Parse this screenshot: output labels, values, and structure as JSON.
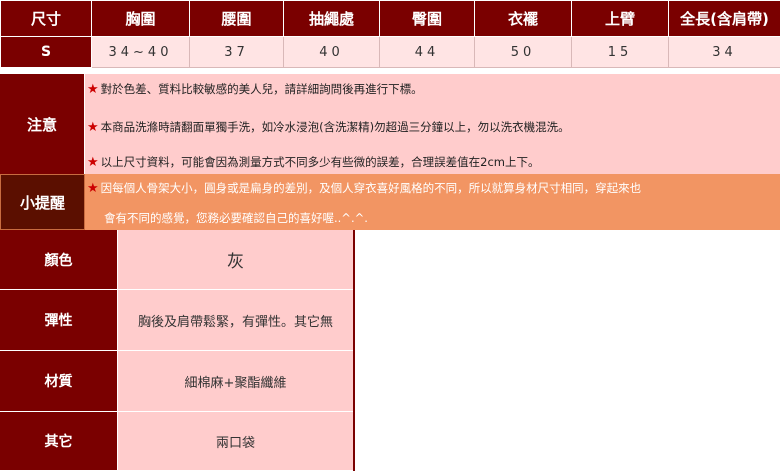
{
  "size_table": {
    "headers": [
      "尺寸",
      "胸圍",
      "腰圍",
      "抽繩處",
      "臀圍",
      "衣襬",
      "上臂",
      "全長(含肩帶)"
    ],
    "rows": [
      {
        "size": "S",
        "values": [
          "34~40",
          "37",
          "40",
          "44",
          "50",
          "15",
          "34"
        ]
      }
    ]
  },
  "notes": {
    "label": "注意",
    "star_glyph": "★",
    "lines": [
      "對於色差、質料比較敏感的美人兒，請詳細詢問後再進行下標。",
      "本商品洗滌時請翻面單獨手洗，如冷水浸泡(含洗潔精)勿超過三分鐘以上，勿以洗衣機混洗。",
      "以上尺寸資料，可能會因為測量方式不同多少有些微的誤差，合理誤差值在2cm上下。"
    ]
  },
  "reminder": {
    "label": "小提醒",
    "line1": "因每個人骨架大小，圓身或是扁身的差別，及個人穿衣喜好風格的不同，所以就算身材尺寸相同，穿起來也",
    "line2": "會有不同的感覺，您務必要確認自己的喜好喔..^.^."
  },
  "attributes": [
    {
      "label": "顏色",
      "value": "灰"
    },
    {
      "label": "彈性",
      "value": "胸後及肩帶鬆緊，有彈性。其它無"
    },
    {
      "label": "材質",
      "value": "細棉麻+聚酯纖維"
    },
    {
      "label": "其它",
      "value": "兩口袋"
    }
  ],
  "colors": {
    "header_bg": "#7a0000",
    "row_bg": "#ffe4e4",
    "notes_bg": "#ffcccc",
    "reminder_bg": "#f29563",
    "reminder_label_bg": "#5b0f00",
    "star": "#cc0000"
  }
}
